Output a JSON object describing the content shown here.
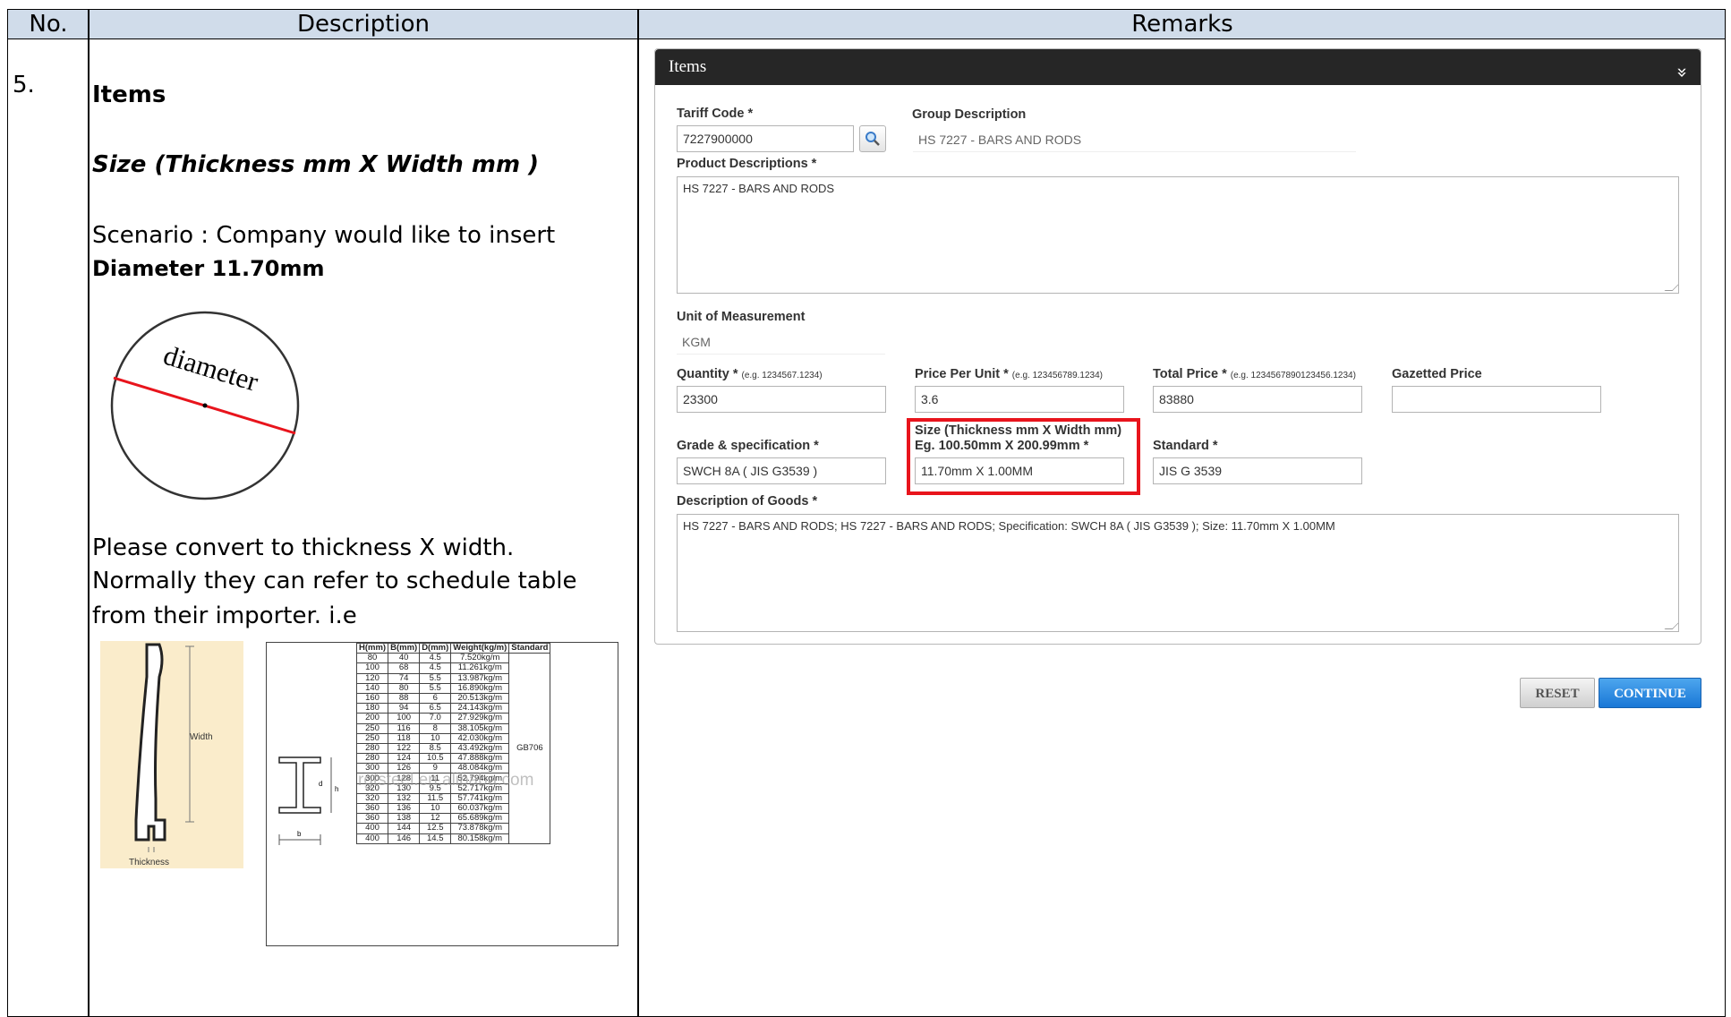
{
  "header": {
    "col_no": "No.",
    "col_desc": "Description",
    "col_remarks": "Remarks"
  },
  "row": {
    "number": "5.",
    "title": "Items",
    "subtitle": "Size (Thickness mm X Width mm )",
    "scenario_line1": "Scenario : Company would like to insert",
    "scenario_line2": "Diameter 11.70mm",
    "diagram_label": "diameter",
    "note_line1": "Please convert to thickness X width.",
    "note_line2": "Normally they can refer to schedule table",
    "note_line3": "from their importer. i.e",
    "profile_width_label": "Width",
    "profile_thickness_label": "Thickness",
    "schedule": {
      "headers": [
        "H(mm)",
        "B(mm)",
        "D(mm)",
        "Weight(kg/m)",
        "Standard"
      ],
      "rows": [
        [
          "80",
          "40",
          "4.5",
          "7.520kg/m"
        ],
        [
          "100",
          "68",
          "4.5",
          "11.261kg/m"
        ],
        [
          "120",
          "74",
          "5.5",
          "13.987kg/m"
        ],
        [
          "140",
          "80",
          "5.5",
          "16.890kg/m"
        ],
        [
          "160",
          "88",
          "6",
          "20.513kg/m"
        ],
        [
          "180",
          "94",
          "6.5",
          "24.143kg/m"
        ],
        [
          "200",
          "100",
          "7.0",
          "27.929kg/m"
        ],
        [
          "250",
          "116",
          "8",
          "38.105kg/m"
        ],
        [
          "250",
          "118",
          "10",
          "42.030kg/m"
        ],
        [
          "280",
          "122",
          "8.5",
          "43.492kg/m"
        ],
        [
          "280",
          "124",
          "10.5",
          "47.888kg/m"
        ],
        [
          "300",
          "126",
          "9",
          "48.084kg/m"
        ],
        [
          "300",
          "128",
          "11",
          "52.794kg/m"
        ],
        [
          "320",
          "130",
          "9.5",
          "52.717kg/m"
        ],
        [
          "320",
          "132",
          "11.5",
          "57.741kg/m"
        ],
        [
          "360",
          "136",
          "10",
          "60.037kg/m"
        ],
        [
          "360",
          "138",
          "12",
          "65.689kg/m"
        ],
        [
          "400",
          "144",
          "12.5",
          "73.878kg/m"
        ],
        [
          "400",
          "146",
          "14.5",
          "80.158kg/m"
        ]
      ],
      "standard": "GB706",
      "watermark": "rgtsteel.en.alibaba.com",
      "dim_labels": {
        "d": "d",
        "h": "h",
        "b": "b"
      }
    }
  },
  "panel": {
    "title": "Items",
    "tariff_code": {
      "label": "Tariff Code *",
      "value": "7227900000"
    },
    "group_description": {
      "label": "Group Description",
      "value": "HS 7227 - BARS AND RODS"
    },
    "product_descriptions": {
      "label": "Product Descriptions *",
      "value": "HS 7227 - BARS AND RODS"
    },
    "unit_of_measurement": {
      "label": "Unit of Measurement",
      "value": "KGM"
    },
    "quantity": {
      "label": "Quantity *",
      "hint": "(e.g. 1234567.1234)",
      "value": "23300"
    },
    "price_per_unit": {
      "label": "Price Per Unit *",
      "hint": "(e.g. 123456789.1234)",
      "value": "3.6"
    },
    "total_price": {
      "label": "Total Price *",
      "hint": "(e.g. 1234567890123456.1234)",
      "value": "83880"
    },
    "gazetted_price": {
      "label": "Gazetted Price",
      "value": ""
    },
    "grade_spec": {
      "label": "Grade & specification *",
      "value": "SWCH 8A ( JIS G3539 )"
    },
    "size": {
      "label_line1": "Size (Thickness mm X Width mm)",
      "label_line2": "Eg. 100.50mm X 200.99mm *",
      "value": "11.70mm X 1.00MM"
    },
    "standard": {
      "label": "Standard *",
      "value": "JIS G 3539"
    },
    "description_of_goods": {
      "label": "Description of Goods *",
      "value": "HS 7227 - BARS AND RODS; HS 7227 - BARS AND RODS; Specification: SWCH 8A ( JIS G3539 ); Size: 11.70mm X 1.00MM"
    },
    "reset_label": "RESET",
    "continue_label": "CONTINUE"
  },
  "colors": {
    "header_bg": "#d0dcea",
    "highlight": "#e8141c",
    "continue": "#2384dc",
    "panel_title_bg": "#262626"
  }
}
